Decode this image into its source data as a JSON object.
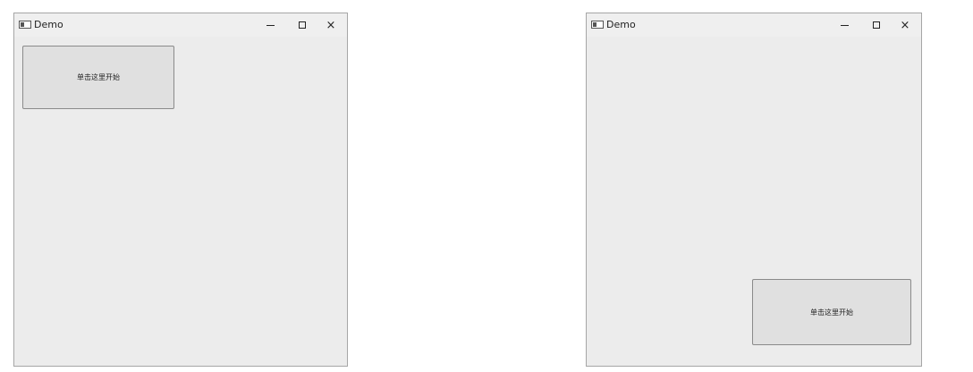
{
  "windows": [
    {
      "title": "Demo",
      "controls": {
        "minimize": "minimize",
        "maximize": "maximize",
        "close": "×"
      },
      "button_label": "单击这里开始"
    },
    {
      "title": "Demo",
      "controls": {
        "minimize": "minimize",
        "maximize": "maximize",
        "close": "×"
      },
      "button_label": "单击这里开始"
    }
  ],
  "colors": {
    "window_bg": "#ececec",
    "window_border": "#a6a6a6",
    "button_bg": "#e0e0e0",
    "button_border": "#8a8a8a",
    "text": "#222222"
  },
  "icons": [
    "app-window-icon",
    "minimize-icon",
    "maximize-icon",
    "close-icon"
  ]
}
